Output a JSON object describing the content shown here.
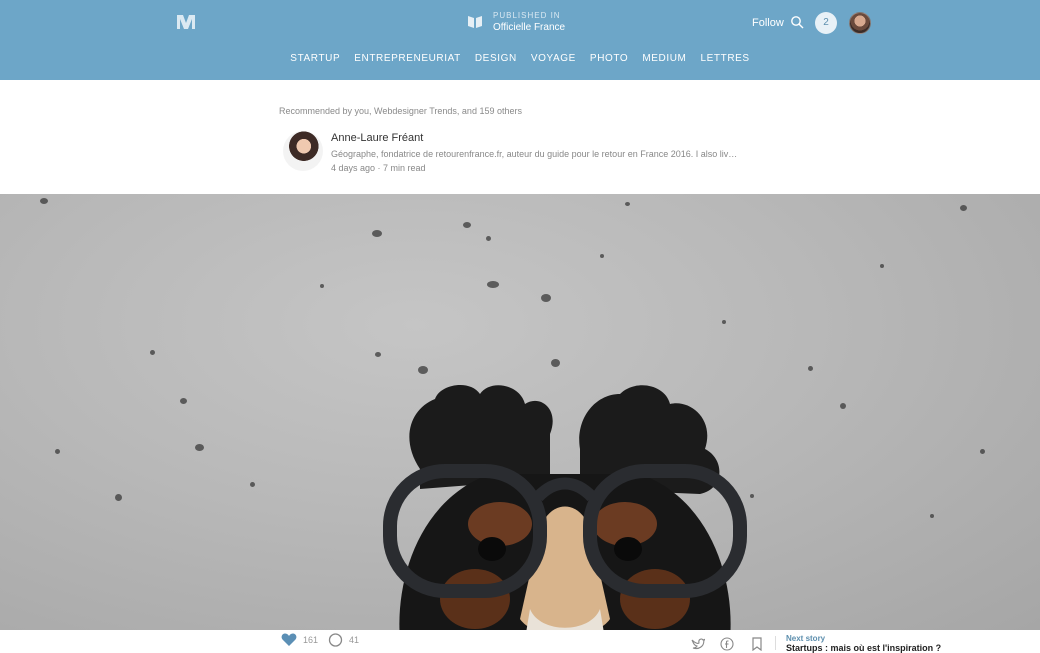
{
  "header": {
    "logo_icon": "medium-logo-icon",
    "publication": {
      "label": "PUBLISHED IN",
      "name": "Officielle France"
    },
    "follow_label": "Follow",
    "search_icon": "search-icon",
    "notifications_count": "2",
    "avatar": "user-avatar",
    "bg_color": "#6da6c8"
  },
  "nav": {
    "items": [
      "STARTUP",
      "ENTREPRENEURIAT",
      "DESIGN",
      "VOYAGE",
      "PHOTO",
      "MEDIUM",
      "LETTRES"
    ]
  },
  "article": {
    "recommended": "Recommended by you, Webdesigner Trends, and 159 others",
    "author": {
      "name": "Anne-Laure Fréant",
      "bio": "Géographe, fondatrice de retourenfrance.fr, auteur du guide pour le retour en France 2016. I also liv…",
      "meta": "4 days ago · 7 min read"
    }
  },
  "footer": {
    "likes": "161",
    "comments": "41",
    "next_label": "Next story",
    "next_title": "Startups : mais où est l'inspiration ?",
    "icons": [
      "twitter-icon",
      "facebook-icon",
      "bookmark-icon"
    ],
    "like_color": "#5b8fb5"
  }
}
